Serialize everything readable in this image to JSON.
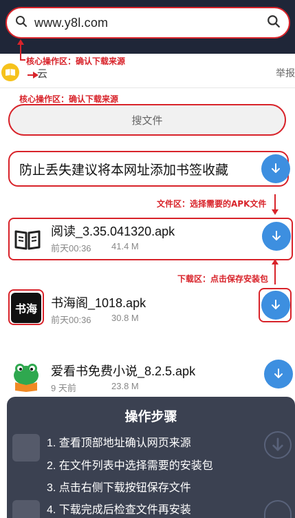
{
  "address_bar": {
    "url": "www.y8l.com"
  },
  "annotations": {
    "core_area_1": "核心操作区：确认下载来源",
    "core_area_2": "核心操作区：确认下载来源",
    "file_area": "文件区：选择需要的APK文件",
    "download_area": "下载区：点击保存安装包"
  },
  "site_header": {
    "name": "云",
    "report": "举报"
  },
  "search_button": {
    "label": "搜文件"
  },
  "bookmark_banner": {
    "text": "防止丢失建议将本网址添加书签收藏"
  },
  "files": [
    {
      "name": "阅读_3.35.041320.apk",
      "date": "前天00:36",
      "size": "41.4 M"
    },
    {
      "name": "书海阁_1018.apk",
      "date": "前天00:36",
      "size": "30.8 M",
      "icon_text": "书海"
    },
    {
      "name": "爱看书免费小说_8.2.5.apk",
      "date": "9 天前",
      "size": "23.8 M"
    }
  ],
  "steps_panel": {
    "title": "操作步骤",
    "steps": [
      "1. 查看顶部地址确认网页来源",
      "2. 在文件列表中选择需要的安装包",
      "3. 点击右侧下载按钮保存文件",
      "4. 下载完成后检查文件再安装"
    ]
  },
  "colors": {
    "accent_red": "#d8232a",
    "download_blue": "#3d8fe0",
    "topbar": "#1f2638"
  }
}
